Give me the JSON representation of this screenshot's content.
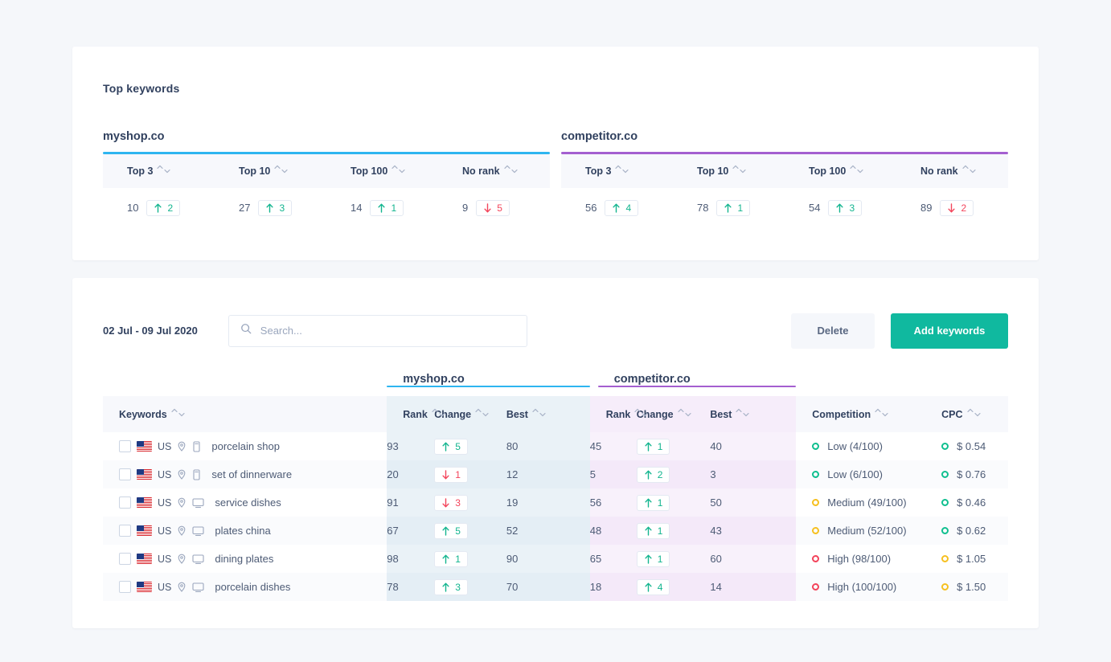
{
  "top_card": {
    "title": "Top keywords",
    "metric_columns": [
      "Top 3",
      "Top 10",
      "Top 100",
      "No rank"
    ],
    "domains": [
      {
        "name": "myshop.co",
        "accent": "#2eb5f0",
        "values": [
          {
            "value": "10",
            "delta": "2",
            "dir": "up"
          },
          {
            "value": "27",
            "delta": "3",
            "dir": "up"
          },
          {
            "value": "14",
            "delta": "1",
            "dir": "up"
          },
          {
            "value": "9",
            "delta": "5",
            "dir": "down"
          }
        ]
      },
      {
        "name": "competitor.co",
        "accent": "#a45fd0",
        "values": [
          {
            "value": "56",
            "delta": "4",
            "dir": "up"
          },
          {
            "value": "78",
            "delta": "1",
            "dir": "up"
          },
          {
            "value": "54",
            "delta": "3",
            "dir": "up"
          },
          {
            "value": "89",
            "delta": "2",
            "dir": "down"
          }
        ]
      }
    ]
  },
  "toolbar": {
    "date_range": "02 Jul - 09 Jul 2020",
    "search_placeholder": "Search...",
    "search_value": "",
    "delete_label": "Delete",
    "add_label": "Add keywords"
  },
  "table": {
    "group_headers": [
      {
        "name": "myshop.co",
        "accent": "#2eb5f0"
      },
      {
        "name": "competitor.co",
        "accent": "#a45fd0"
      }
    ],
    "columns": {
      "keywords": "Keywords",
      "rank": "Rank",
      "change": "Change",
      "best": "Best",
      "competition": "Competition",
      "cpc": "CPC"
    },
    "rows": [
      {
        "country": "US",
        "device": "mobile",
        "keyword": "porcelain shop",
        "myshop": {
          "rank": "93",
          "change": "5",
          "dir": "up",
          "best": "80"
        },
        "competitor": {
          "rank": "45",
          "change": "1",
          "dir": "up",
          "best": "40"
        },
        "competition": {
          "label": "Low (4/100)",
          "level": "low"
        },
        "cpc": {
          "value": "$ 0.54",
          "level": "low"
        }
      },
      {
        "country": "US",
        "device": "mobile",
        "keyword": "set of dinnerware",
        "myshop": {
          "rank": "20",
          "change": "1",
          "dir": "down",
          "best": "12"
        },
        "competitor": {
          "rank": "5",
          "change": "2",
          "dir": "up",
          "best": "3"
        },
        "competition": {
          "label": "Low  (6/100)",
          "level": "low"
        },
        "cpc": {
          "value": "$ 0.76",
          "level": "low"
        }
      },
      {
        "country": "US",
        "device": "desktop",
        "keyword": "service dishes",
        "myshop": {
          "rank": "91",
          "change": "3",
          "dir": "down",
          "best": "19"
        },
        "competitor": {
          "rank": "56",
          "change": "1",
          "dir": "up",
          "best": "50"
        },
        "competition": {
          "label": "Medium  (49/100)",
          "level": "medium"
        },
        "cpc": {
          "value": "$ 0.46",
          "level": "low"
        }
      },
      {
        "country": "US",
        "device": "desktop",
        "keyword": "plates china",
        "myshop": {
          "rank": "67",
          "change": "5",
          "dir": "up",
          "best": "52"
        },
        "competitor": {
          "rank": "48",
          "change": "1",
          "dir": "up",
          "best": "43"
        },
        "competition": {
          "label": "Medium  (52/100)",
          "level": "medium"
        },
        "cpc": {
          "value": "$ 0.62",
          "level": "low"
        }
      },
      {
        "country": "US",
        "device": "desktop",
        "keyword": "dining plates",
        "myshop": {
          "rank": "98",
          "change": "1",
          "dir": "up",
          "best": "90"
        },
        "competitor": {
          "rank": "65",
          "change": "1",
          "dir": "up",
          "best": "60"
        },
        "competition": {
          "label": "High (98/100)",
          "level": "high"
        },
        "cpc": {
          "value": "$ 1.05",
          "level": "medium"
        }
      },
      {
        "country": "US",
        "device": "desktop",
        "keyword": "porcelain dishes",
        "myshop": {
          "rank": "78",
          "change": "3",
          "dir": "up",
          "best": "70"
        },
        "competitor": {
          "rank": "18",
          "change": "4",
          "dir": "up",
          "best": "14"
        },
        "competition": {
          "label": "High (100/100)",
          "level": "high"
        },
        "cpc": {
          "value": "$ 1.50",
          "level": "medium"
        }
      }
    ]
  }
}
